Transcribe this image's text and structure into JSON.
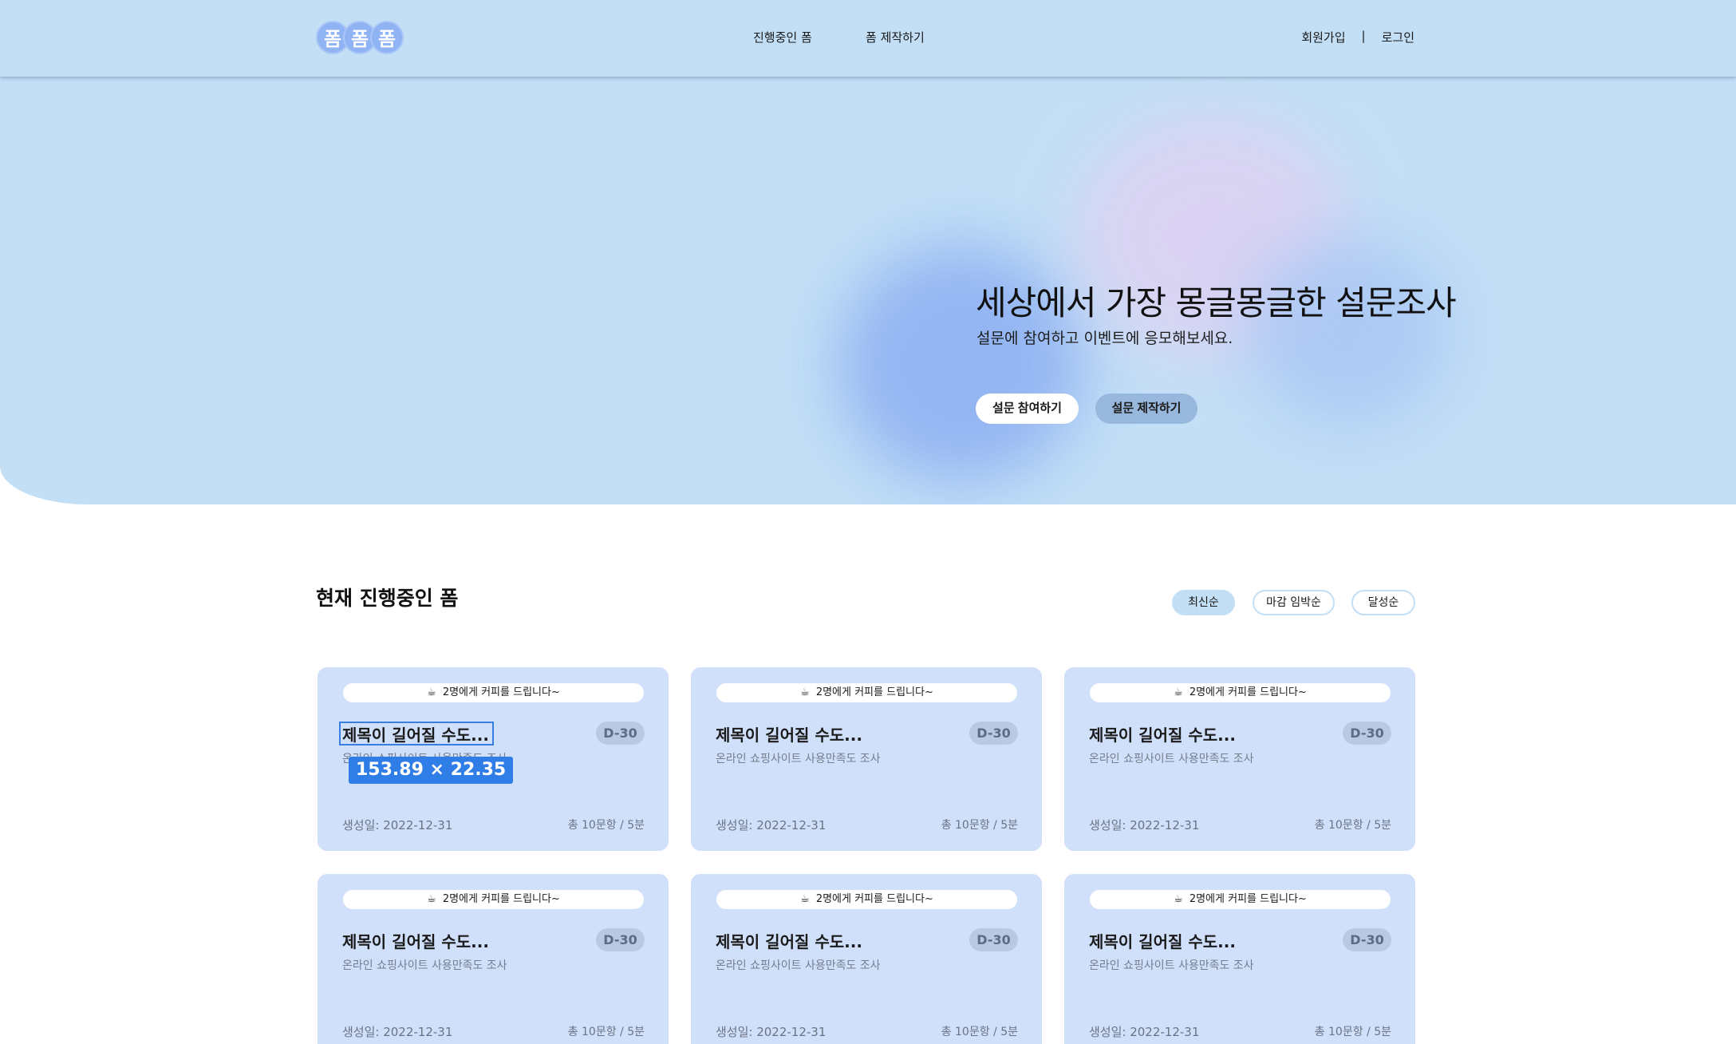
{
  "header": {
    "logo_chars": [
      "폼",
      "폼",
      "폼"
    ],
    "nav": [
      "진행중인 폼",
      "폼 제작하기"
    ],
    "signup": "회원가입",
    "separator": "|",
    "login": "로그인"
  },
  "hero": {
    "title": "세상에서 가장 몽글몽글한 설문조사",
    "subtitle": "설문에 참여하고 이벤트에 응모해보세요.",
    "join_button": "설문 참여하기",
    "make_button": "설문 제작하기"
  },
  "section": {
    "title": "현재 진행중인 폼",
    "sort_options": [
      "최신순",
      "마감 임박순",
      "달성순"
    ],
    "selected_sort": "최신순"
  },
  "cards": [
    {
      "banner_icon": "☕",
      "banner": "2명에게 커피를 드립니다~",
      "title": "제목이 길어질 수도...",
      "badge": "D-30",
      "desc": "온라인 쇼핑사이트 사용만족도 조사",
      "date": "생성일: 2022-12-31",
      "meta": "총 10문항 / 5분"
    },
    {
      "banner_icon": "☕",
      "banner": "2명에게 커피를 드립니다~",
      "title": "제목이 길어질 수도...",
      "badge": "D-30",
      "desc": "온라인 쇼핑사이트 사용만족도 조사",
      "date": "생성일: 2022-12-31",
      "meta": "총 10문항 / 5분"
    },
    {
      "banner_icon": "☕",
      "banner": "2명에게 커피를 드립니다~",
      "title": "제목이 길어질 수도...",
      "badge": "D-30",
      "desc": "온라인 쇼핑사이트 사용만족도 조사",
      "date": "생성일: 2022-12-31",
      "meta": "총 10문항 / 5분"
    },
    {
      "banner_icon": "☕",
      "banner": "2명에게 커피를 드립니다~",
      "title": "제목이 길어질 수도...",
      "badge": "D-30",
      "desc": "온라인 쇼핑사이트 사용만족도 조사",
      "date": "생성일: 2022-12-31",
      "meta": "총 10문항 / 5분"
    },
    {
      "banner_icon": "☕",
      "banner": "2명에게 커피를 드립니다~",
      "title": "제목이 길어질 수도...",
      "badge": "D-30",
      "desc": "온라인 쇼핑사이트 사용만족도 조사",
      "date": "생성일: 2022-12-31",
      "meta": "총 10문항 / 5분"
    },
    {
      "banner_icon": "☕",
      "banner": "2명에게 커피를 드립니다~",
      "title": "제목이 길어질 수도...",
      "badge": "D-30",
      "desc": "온라인 쇼핑사이트 사용만족도 조사",
      "date": "생성일: 2022-12-31",
      "meta": "총 10문항 / 5분"
    }
  ],
  "overlay": {
    "size_label": "153.89 × 22.35"
  },
  "colors": {
    "hero_bg": "#c2dff6",
    "card_bg": "#d0e0fa",
    "badge_bg": "#b9c9e3",
    "accent": "#2f7de6"
  }
}
